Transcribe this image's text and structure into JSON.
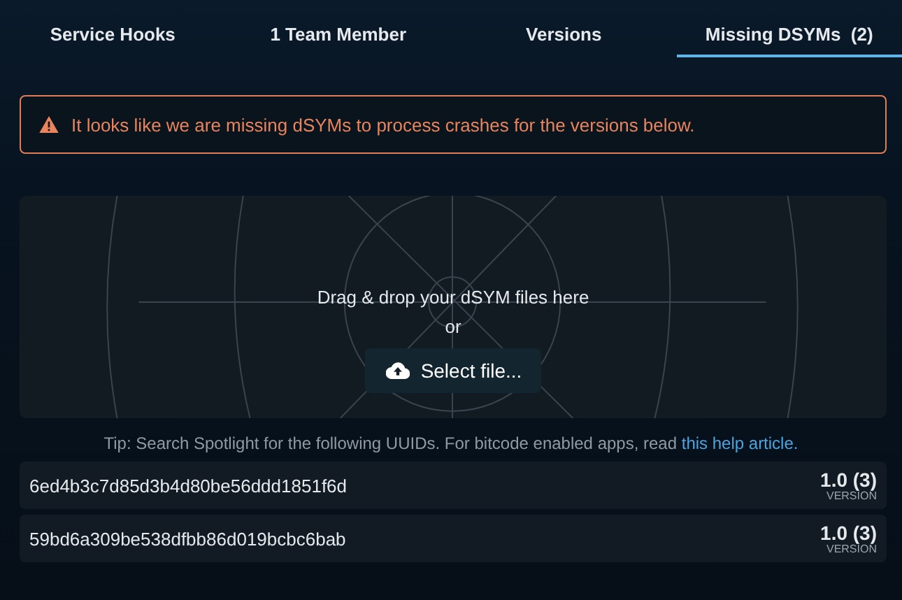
{
  "tabs": [
    {
      "label": "Service Hooks",
      "selected": false
    },
    {
      "label": "1 Team Member",
      "selected": false
    },
    {
      "label": "Versions",
      "selected": false
    },
    {
      "label": "Missing DSYMs  (2)",
      "selected": true
    }
  ],
  "alert": {
    "message": "It looks like we are missing dSYMs to process crashes for the versions below."
  },
  "dropzone": {
    "instruction": "Drag & drop your dSYM files here",
    "or": "or",
    "button": "Select file..."
  },
  "tip": {
    "text": "Tip: Search Spotlight for the following UUIDs. For bitcode enabled apps, read ",
    "link": "this help article."
  },
  "uuids": [
    {
      "uuid": "6ed4b3c7d85d3b4d80be56ddd1851f6d",
      "version": "1.0 (3)",
      "version_label": "VERSION"
    },
    {
      "uuid": "59bd6a309be538dfbb86d019bcbc6bab",
      "version": "1.0 (3)",
      "version_label": "VERSION"
    }
  ]
}
